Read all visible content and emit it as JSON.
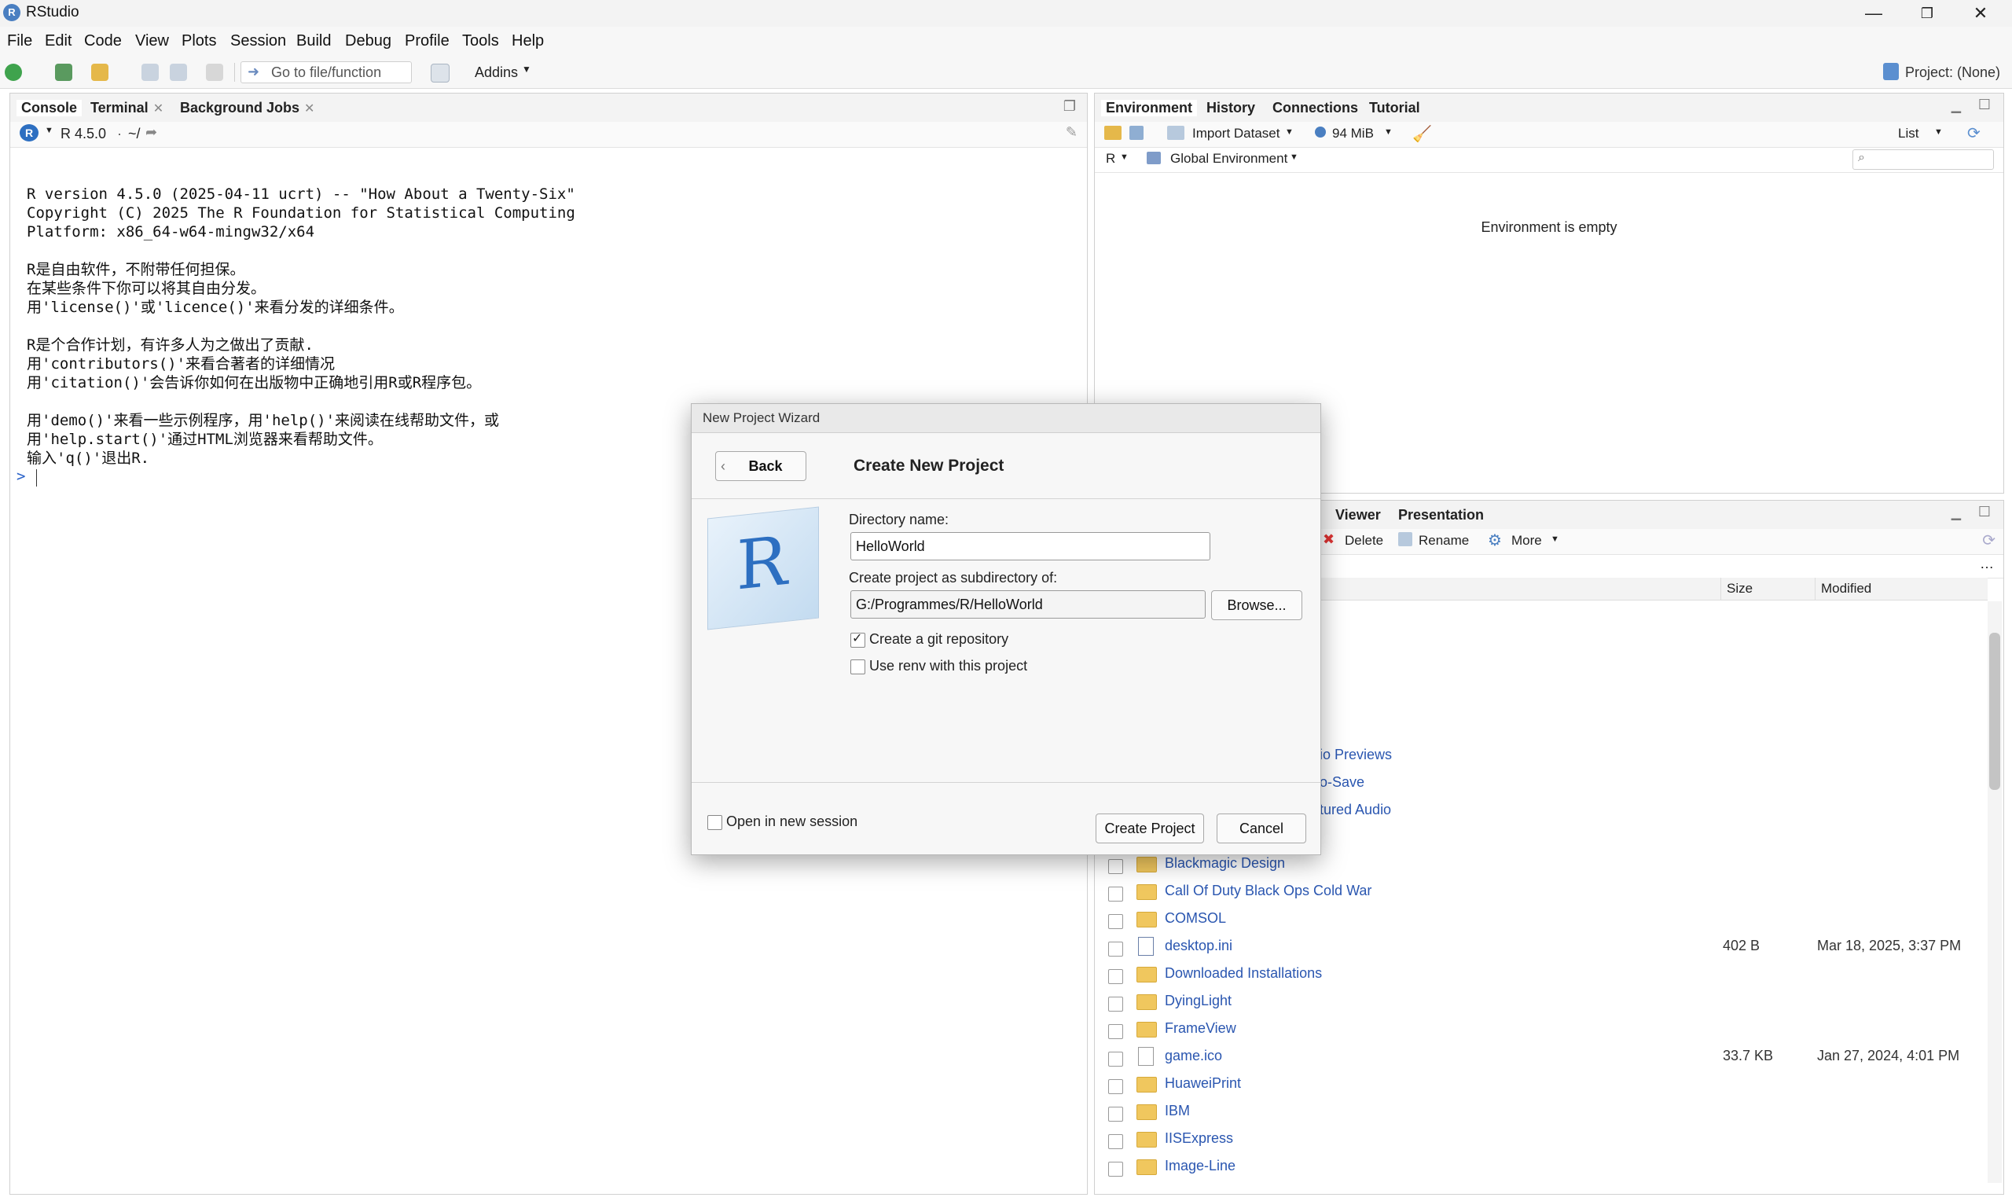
{
  "window": {
    "title": "RStudio",
    "app_icon": "R"
  },
  "menu": [
    "File",
    "Edit",
    "Code",
    "View",
    "Plots",
    "Session",
    "Build",
    "Debug",
    "Profile",
    "Tools",
    "Help"
  ],
  "toolbar": {
    "goto_placeholder": "Go to file/function",
    "addins": "Addins",
    "project": "Project: (None)"
  },
  "left_pane": {
    "tabs": [
      "Console",
      "Terminal",
      "Background Jobs"
    ],
    "r_version": "R 4.5.0",
    "path": "~/",
    "console_lines": [
      "R version 4.5.0 (2025-04-11 ucrt) -- \"How About a Twenty-Six\"",
      "Copyright (C) 2025 The R Foundation for Statistical Computing",
      "Platform: x86_64-w64-mingw32/x64",
      "",
      "R是自由软件，不附带任何担保。",
      "在某些条件下你可以将其自由分发。",
      "用'license()'或'licence()'来看分发的详细条件。",
      "",
      "R是个合作计划，有许多人为之做出了贡献.",
      "用'contributors()'来看合著者的详细情况",
      "用'citation()'会告诉你如何在出版物中正确地引用R或R程序包。",
      "",
      "用'demo()'来看一些示例程序，用'help()'来阅读在线帮助文件，或",
      "用'help.start()'通过HTML浏览器来看帮助文件。",
      "输入'q()'退出R."
    ],
    "prompt": ">"
  },
  "env_pane": {
    "tabs": [
      "Environment",
      "History",
      "Connections",
      "Tutorial"
    ],
    "import_dataset": "Import Dataset",
    "memory": "94 MiB",
    "list_view": "List",
    "language": "R",
    "scope": "Global Environment",
    "empty_message": "Environment is empty"
  },
  "files_pane": {
    "tabs": [
      "Viewer",
      "Presentation"
    ],
    "actions": {
      "delete": "Delete",
      "rename": "Rename",
      "more": "More"
    },
    "columns": {
      "size": "Size",
      "modified": "Modified"
    },
    "partial_rows": [
      "io Previews",
      "o-Save",
      "tured Audio"
    ],
    "rows": [
      {
        "name": "Blackmagic Design",
        "type": "folder",
        "size": "",
        "modified": ""
      },
      {
        "name": "Call Of Duty Black Ops Cold War",
        "type": "folder",
        "size": "",
        "modified": ""
      },
      {
        "name": "COMSOL",
        "type": "folder",
        "size": "",
        "modified": ""
      },
      {
        "name": "desktop.ini",
        "type": "config",
        "size": "402 B",
        "modified": "Mar 18, 2025, 3:37 PM"
      },
      {
        "name": "Downloaded Installations",
        "type": "folder",
        "size": "",
        "modified": ""
      },
      {
        "name": "DyingLight",
        "type": "folder",
        "size": "",
        "modified": ""
      },
      {
        "name": "FrameView",
        "type": "folder",
        "size": "",
        "modified": ""
      },
      {
        "name": "game.ico",
        "type": "file",
        "size": "33.7 KB",
        "modified": "Jan 27, 2024, 4:01 PM"
      },
      {
        "name": "HuaweiPrint",
        "type": "folder",
        "size": "",
        "modified": ""
      },
      {
        "name": "IBM",
        "type": "folder",
        "size": "",
        "modified": ""
      },
      {
        "name": "IISExpress",
        "type": "folder",
        "size": "",
        "modified": ""
      },
      {
        "name": "Image-Line",
        "type": "folder",
        "size": "",
        "modified": ""
      }
    ]
  },
  "dialog": {
    "window_title": "New Project Wizard",
    "back": "Back",
    "heading": "Create New Project",
    "dir_name_label": "Directory name:",
    "dir_name_value": "HelloWorld",
    "subdir_label": "Create project as subdirectory of:",
    "subdir_value": "G:/Programmes/R/HelloWorld",
    "browse": "Browse...",
    "git_label": "Create a git repository",
    "git_checked": true,
    "renv_label": "Use renv with this project",
    "renv_checked": false,
    "new_session_label": "Open in new session",
    "new_session_checked": false,
    "create": "Create Project",
    "cancel": "Cancel"
  }
}
